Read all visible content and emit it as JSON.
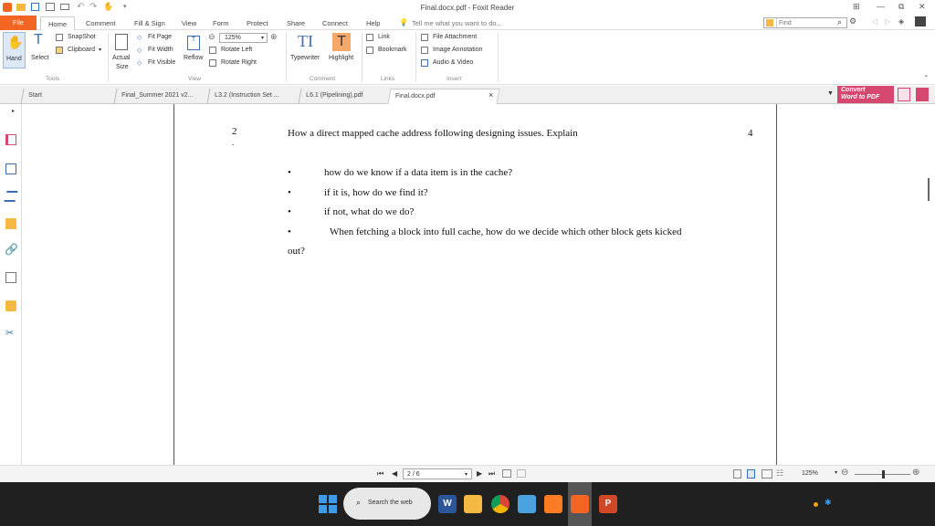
{
  "window": {
    "title": "Final.docx.pdf - Foxit Reader"
  },
  "menu": {
    "file": "File",
    "home": "Home",
    "comment": "Comment",
    "fill_sign": "Fill & Sign",
    "view": "View",
    "form": "Form",
    "protect": "Protect",
    "share": "Share",
    "connect": "Connect",
    "help": "Help",
    "tell_me": "Tell me what you want to do..."
  },
  "search": {
    "placeholder": "Find"
  },
  "ribbon": {
    "hand": "Hand",
    "select": "Select",
    "snapshot": "SnapShot",
    "clipboard": "Clipboard",
    "actual_size_1": "Actual",
    "actual_size_2": "Size",
    "fit_page": "Fit Page",
    "fit_width": "Fit Width",
    "fit_visible": "Fit Visible",
    "reflow": "Reflow",
    "zoom": "125%",
    "rotate_left": "Rotate Left",
    "rotate_right": "Rotate Right",
    "typewriter": "Typewriter",
    "highlight": "Highlight",
    "link": "Link",
    "bookmark": "Bookmark",
    "file_attachment": "File Attachment",
    "image_annotation": "Image Annotation",
    "audio_video": "Audio & Video",
    "groups": {
      "tools": "Tools",
      "view": "View",
      "comment": "Comment",
      "links": "Links",
      "insert": "Insert"
    }
  },
  "tabs": [
    {
      "label": "Start"
    },
    {
      "label": "Final_Summer 2021 v2..."
    },
    {
      "label": "L3.2 (Instruction Set ..."
    },
    {
      "label": "L6.1 (Pipelining).pdf"
    },
    {
      "label": "Final.docx.pdf",
      "close": "×"
    }
  ],
  "convert": {
    "line1": "Convert",
    "line2": "Word to PDF"
  },
  "document": {
    "question_number": "2",
    "question_dot": ".",
    "question_text": "How a direct mapped cache address following designing issues. Explain",
    "marks": "4",
    "bullets": [
      "how do we know if a data item is in the cache?",
      "if it is, how do we find it?",
      "if not, what do we do?",
      "When fetching a block into full cache, how do we decide which other block gets kicked"
    ],
    "bullet_continuation": "out?"
  },
  "status": {
    "page": "2 / 6",
    "zoom": "125%"
  },
  "taskbar": {
    "search": "Search the web"
  },
  "colors": {
    "foxit_orange": "#f26522",
    "convert_pink": "#d6486f",
    "taskbar": "#202020"
  }
}
